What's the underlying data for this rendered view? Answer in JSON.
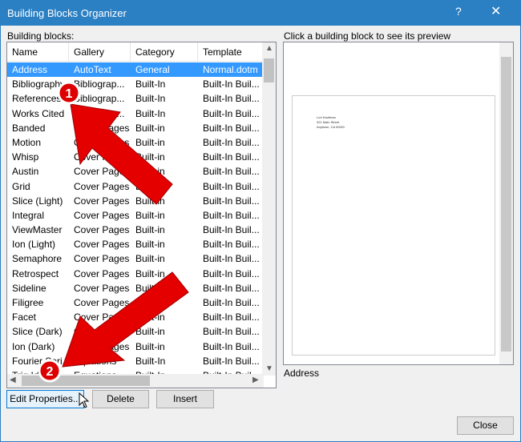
{
  "window": {
    "title": "Building Blocks Organizer",
    "help": "?",
    "close": "✕"
  },
  "list_label": "Building blocks:",
  "columns": [
    "Name",
    "Gallery",
    "Category",
    "Template"
  ],
  "rows": [
    [
      "Address",
      "AutoText",
      "General",
      "Normal.dotm"
    ],
    [
      "Bibliography",
      "Bibliograp...",
      "Built-In",
      "Built-In Buil..."
    ],
    [
      "References",
      "Bibliograp...",
      "Built-In",
      "Built-In Buil..."
    ],
    [
      "Works Cited",
      "Bibliograp...",
      "Built-In",
      "Built-In Buil..."
    ],
    [
      "Banded",
      "Cover Pages",
      "Built-in",
      "Built-In Buil..."
    ],
    [
      "Motion",
      "Cover Pages",
      "Built-in",
      "Built-In Buil..."
    ],
    [
      "Whisp",
      "Cover Pages",
      "Built-in",
      "Built-In Buil..."
    ],
    [
      "Austin",
      "Cover Pages",
      "Built-in",
      "Built-In Buil..."
    ],
    [
      "Grid",
      "Cover Pages",
      "Built-in",
      "Built-In Buil..."
    ],
    [
      "Slice (Light)",
      "Cover Pages",
      "Built-in",
      "Built-In Buil..."
    ],
    [
      "Integral",
      "Cover Pages",
      "Built-in",
      "Built-In Buil..."
    ],
    [
      "ViewMaster",
      "Cover Pages",
      "Built-in",
      "Built-In Buil..."
    ],
    [
      "Ion (Light)",
      "Cover Pages",
      "Built-in",
      "Built-In Buil..."
    ],
    [
      "Semaphore",
      "Cover Pages",
      "Built-in",
      "Built-In Buil..."
    ],
    [
      "Retrospect",
      "Cover Pages",
      "Built-in",
      "Built-In Buil..."
    ],
    [
      "Sideline",
      "Cover Pages",
      "Built-in",
      "Built-In Buil..."
    ],
    [
      "Filigree",
      "Cover Pages",
      "Built-in",
      "Built-In Buil..."
    ],
    [
      "Facet",
      "Cover Pages",
      "Built-in",
      "Built-In Buil..."
    ],
    [
      "Slice (Dark)",
      "Cover Pages",
      "Built-in",
      "Built-In Buil..."
    ],
    [
      "Ion (Dark)",
      "Cover Pages",
      "Built-in",
      "Built-In Buil..."
    ],
    [
      "Fourier Seri...",
      "Equations",
      "Built-In",
      "Built-In Buil..."
    ],
    [
      "Trig Identit...",
      "Equations",
      "Built-In",
      "Built-In Buil..."
    ]
  ],
  "buttons": {
    "edit": "Edit Properties...",
    "delete": "Delete",
    "insert": "Insert",
    "close": "Close"
  },
  "preview": {
    "label": "Click a building block to see its preview",
    "lines": [
      "Lori Kaufman",
      "321 Main Street",
      "Anytown, CA 00001"
    ],
    "caption": "Address"
  },
  "annotations": [
    "1",
    "2"
  ],
  "colors": {
    "title": "#2b7fc3",
    "selection": "#3399ff",
    "arrow": "#e50000"
  }
}
